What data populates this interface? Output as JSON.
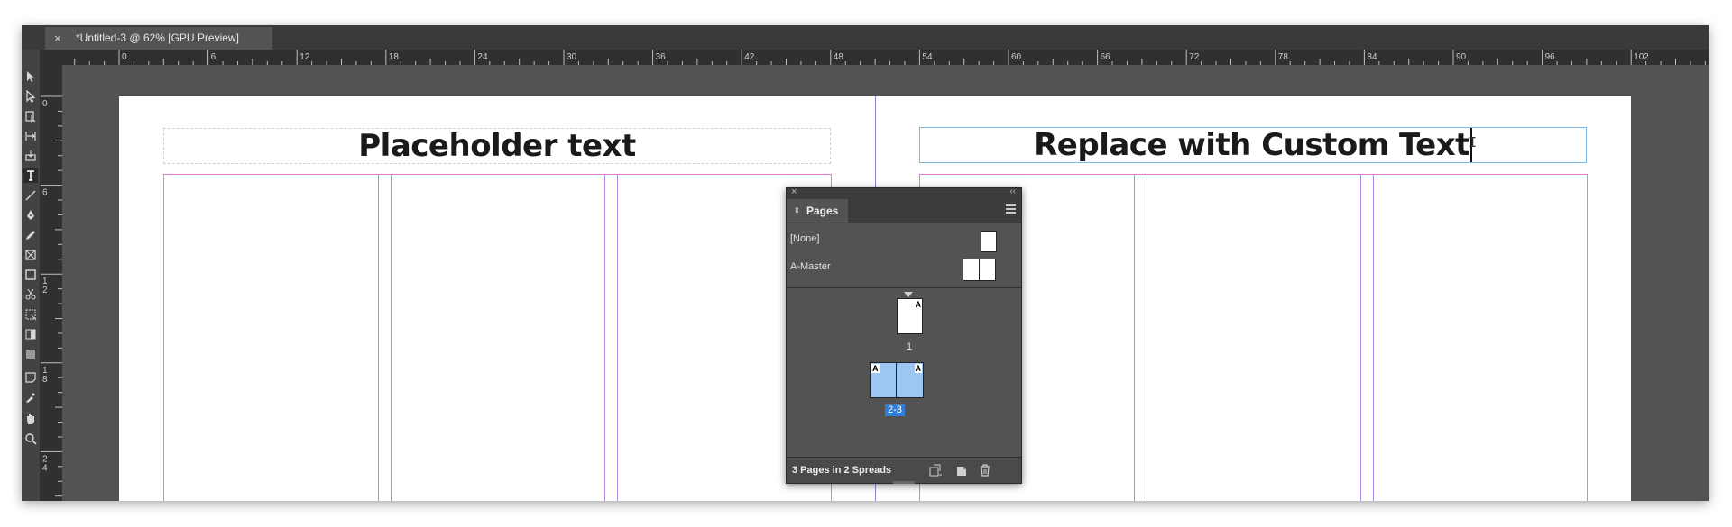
{
  "document_tab": {
    "title": "*Untitled-3 @ 62% [GPU Preview]",
    "close_glyph": "×"
  },
  "toolbox": {
    "tools": [
      "selection-tool",
      "direct-selection-tool",
      "page-tool",
      "gap-tool",
      "content-collector-tool",
      "type-tool",
      "line-tool",
      "pen-tool",
      "pencil-tool",
      "rectangle-frame-tool",
      "rectangle-tool",
      "scissors-tool",
      "free-transform-tool",
      "gradient-swatch-tool",
      "gradient-feather-tool",
      "note-tool",
      "eyedropper-tool",
      "hand-tool",
      "zoom-tool"
    ]
  },
  "ruler": {
    "horizontal_labels": [
      "0",
      "6",
      "12",
      "18",
      "24",
      "30",
      "36",
      "42",
      "48",
      "54",
      "60",
      "66",
      "72",
      "78",
      "84",
      "90",
      "96",
      "102"
    ],
    "vertical_labels": [
      [
        "0"
      ],
      [
        "6"
      ],
      [
        "1",
        "2"
      ],
      [
        "1",
        "8"
      ],
      [
        "2",
        "4"
      ]
    ]
  },
  "canvas": {
    "left_frame_text": "Placeholder text",
    "right_frame_text": "Replace with Custom Text",
    "accent_colors": {
      "frame_selected": "#7fb8df",
      "margin_guide": "#e47ae4",
      "column_guide": "#b98be8"
    }
  },
  "pages_panel": {
    "tab_label": "Pages",
    "masters": [
      {
        "label": "[None]"
      },
      {
        "label": "A-Master"
      }
    ],
    "pages": [
      {
        "number": "1",
        "master_letter": "A"
      },
      {
        "number": "2-3",
        "master_letters": [
          "A",
          "A"
        ],
        "selected": true
      }
    ],
    "status": "3 Pages in 2 Spreads",
    "selected_color": "#9cc6f4"
  }
}
